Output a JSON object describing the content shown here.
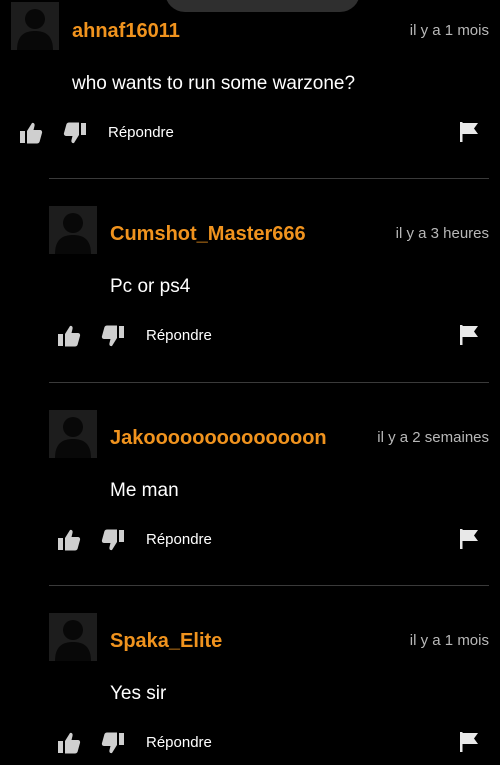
{
  "comments": [
    {
      "username": "ahnaf16011",
      "timestamp": "il y a 1 mois",
      "text": "who wants to run some warzone?",
      "reply_label": "Répondre"
    },
    {
      "username": "Cumshot_Master666",
      "timestamp": "il y a 3 heures",
      "text": "Pc or ps4",
      "reply_label": "Répondre"
    },
    {
      "username": "Jakoooooooooooooon",
      "timestamp": "il y a 2 semaines",
      "text": "Me man",
      "reply_label": "Répondre"
    },
    {
      "username": "Spaka_Elite",
      "timestamp": "il y a 1 mois",
      "text": "Yes sir",
      "reply_label": "Répondre"
    }
  ],
  "colors": {
    "background": "#000000",
    "username": "#f0931e",
    "timestamp": "#b8b8b8",
    "text": "#ffffff",
    "divider": "#3a3a3a"
  },
  "icons": [
    "avatar-placeholder",
    "thumbs-up-icon",
    "thumbs-down-icon",
    "flag-icon"
  ]
}
